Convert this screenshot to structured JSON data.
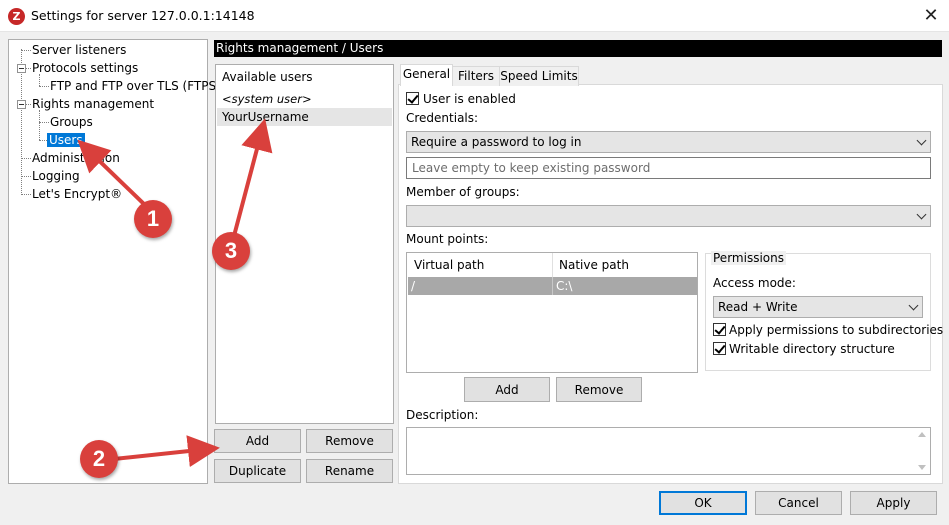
{
  "window": {
    "title": "Settings for server 127.0.0.1:14148",
    "app_icon_letter": "Z",
    "close_glyph": "✕"
  },
  "tree": {
    "items": [
      {
        "label": "Server listeners"
      },
      {
        "label": "Protocols settings"
      },
      {
        "label": "FTP and FTP over TLS (FTPS)"
      },
      {
        "label": "Rights management"
      },
      {
        "label": "Groups"
      },
      {
        "label": "Users",
        "selected": true
      },
      {
        "label": "Administration"
      },
      {
        "label": "Logging"
      },
      {
        "label": "Let's Encrypt®"
      }
    ]
  },
  "header": {
    "title": "Rights management / Users"
  },
  "users": {
    "title": "Available users",
    "items": [
      "<system user>",
      "YourUsername"
    ],
    "add_label": "Add",
    "remove_label": "Remove",
    "duplicate_label": "Duplicate",
    "rename_label": "Rename"
  },
  "tabs": [
    "General",
    "Filters",
    "Speed Limits"
  ],
  "general": {
    "user_enabled_label": "User is enabled",
    "credentials_label": "Credentials:",
    "credentials_value": "Require a password to log in",
    "password_placeholder": "Leave empty to keep existing password",
    "member_groups_label": "Member of groups:",
    "member_groups_value": "",
    "mount_points_label": "Mount points:",
    "mount_columns": [
      "Virtual path",
      "Native path"
    ],
    "mount_rows": [
      {
        "virtual": "/",
        "native": "C:\\"
      }
    ],
    "mount_add_label": "Add",
    "mount_remove_label": "Remove",
    "permissions_title": "Permissions",
    "access_mode_label": "Access mode:",
    "access_mode_value": "Read + Write",
    "apply_subdirs_label": "Apply permissions to subdirectories",
    "writable_dir_label": "Writable directory structure",
    "description_label": "Description:"
  },
  "footer": {
    "ok_label": "OK",
    "cancel_label": "Cancel",
    "apply_label": "Apply"
  },
  "annotations": [
    {
      "number": "1"
    },
    {
      "number": "2"
    },
    {
      "number": "3"
    }
  ],
  "colors": {
    "selection": "#0078d7",
    "annotation": "#d9403c",
    "header_bg": "#000000"
  }
}
